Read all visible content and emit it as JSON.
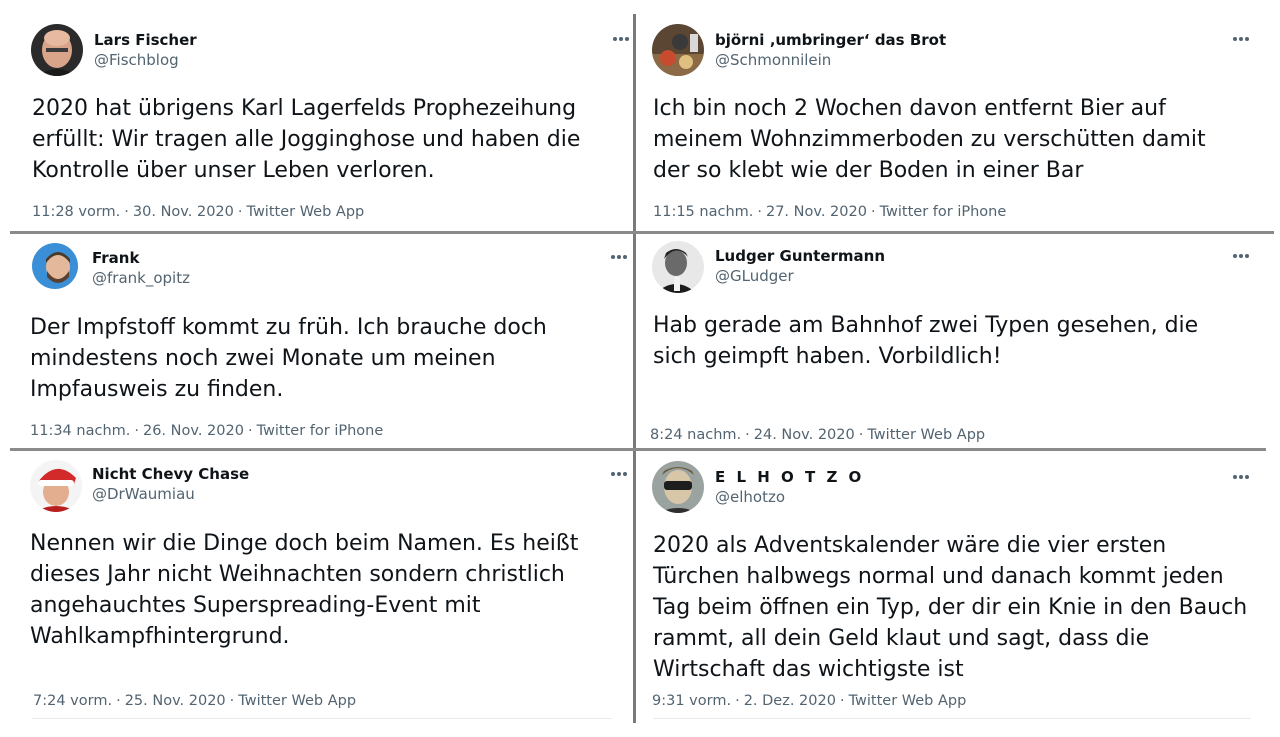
{
  "tweets": [
    {
      "name": "Lars Fischer",
      "handle": "@Fischblog",
      "text": "2020 hat übrigens Karl Lagerfelds Prophezeihung erfüllt: Wir tragen alle Jogginghose und haben die Kontrolle über unser Leben verloren.",
      "time": "11:28 vorm.",
      "date": "30. Nov. 2020",
      "source": "Twitter Web App",
      "avatar_icon": "bald-man-avatar-icon"
    },
    {
      "name": "björni ‚umbringer‘ das Brot",
      "handle": "@Schmonnilein",
      "text": "Ich bin noch 2 Wochen davon entfernt Bier auf meinem Wohnzimmerboden zu verschütten damit der so klebt wie der Boden in einer Bar",
      "time": "11:15 nachm.",
      "date": "27. Nov. 2020",
      "source": "Twitter for iPhone",
      "avatar_icon": "food-table-avatar-icon"
    },
    {
      "name": "Frank",
      "handle": "@frank_opitz",
      "text": "Der Impfstoff kommt zu früh. Ich brauche doch mindestens noch zwei Monate um meinen Impfausweis zu finden.",
      "time": "11:34 nachm.",
      "date": "26. Nov. 2020",
      "source": "Twitter for iPhone",
      "avatar_icon": "bearded-man-avatar-icon"
    },
    {
      "name": "Ludger Guntermann",
      "handle": "@GLudger",
      "text": "Hab gerade am Bahnhof zwei Typen gesehen, die sich geimpft haben. Vorbildlich!",
      "time": "8:24 nachm.",
      "date": "24. Nov. 2020",
      "source": "Twitter Web App",
      "avatar_icon": "bw-portrait-avatar-icon"
    },
    {
      "name": "Nicht Chevy Chase",
      "handle": "@DrWaumiau",
      "text": "Nennen wir die Dinge doch beim Namen. Es heißt dieses Jahr nicht Weihnachten sondern christlich angehauchtes Superspreading-Event mit Wahlkampfhintergrund.",
      "time": "7:24 vorm.",
      "date": "25. Nov. 2020",
      "source": "Twitter Web App",
      "avatar_icon": "santa-hat-avatar-icon"
    },
    {
      "name": "E L H O T Z O",
      "handle": "@elhotzo",
      "text": "2020 als Adventskalender wäre die vier ersten Türchen halbwegs normal und danach kommt jeden Tag beim öffnen ein Typ, der dir ein Knie in den Bauch rammt, all dein Geld klaut und sagt, dass die Wirtschaft das wichtigste ist",
      "time": "9:31 vorm.",
      "date": "2. Dez. 2020",
      "source": "Twitter Web App",
      "avatar_icon": "glasses-avatar-icon"
    }
  ],
  "colors": {
    "text": "#0f1419",
    "secondary": "#536471",
    "divider": "#7a7a7a"
  }
}
